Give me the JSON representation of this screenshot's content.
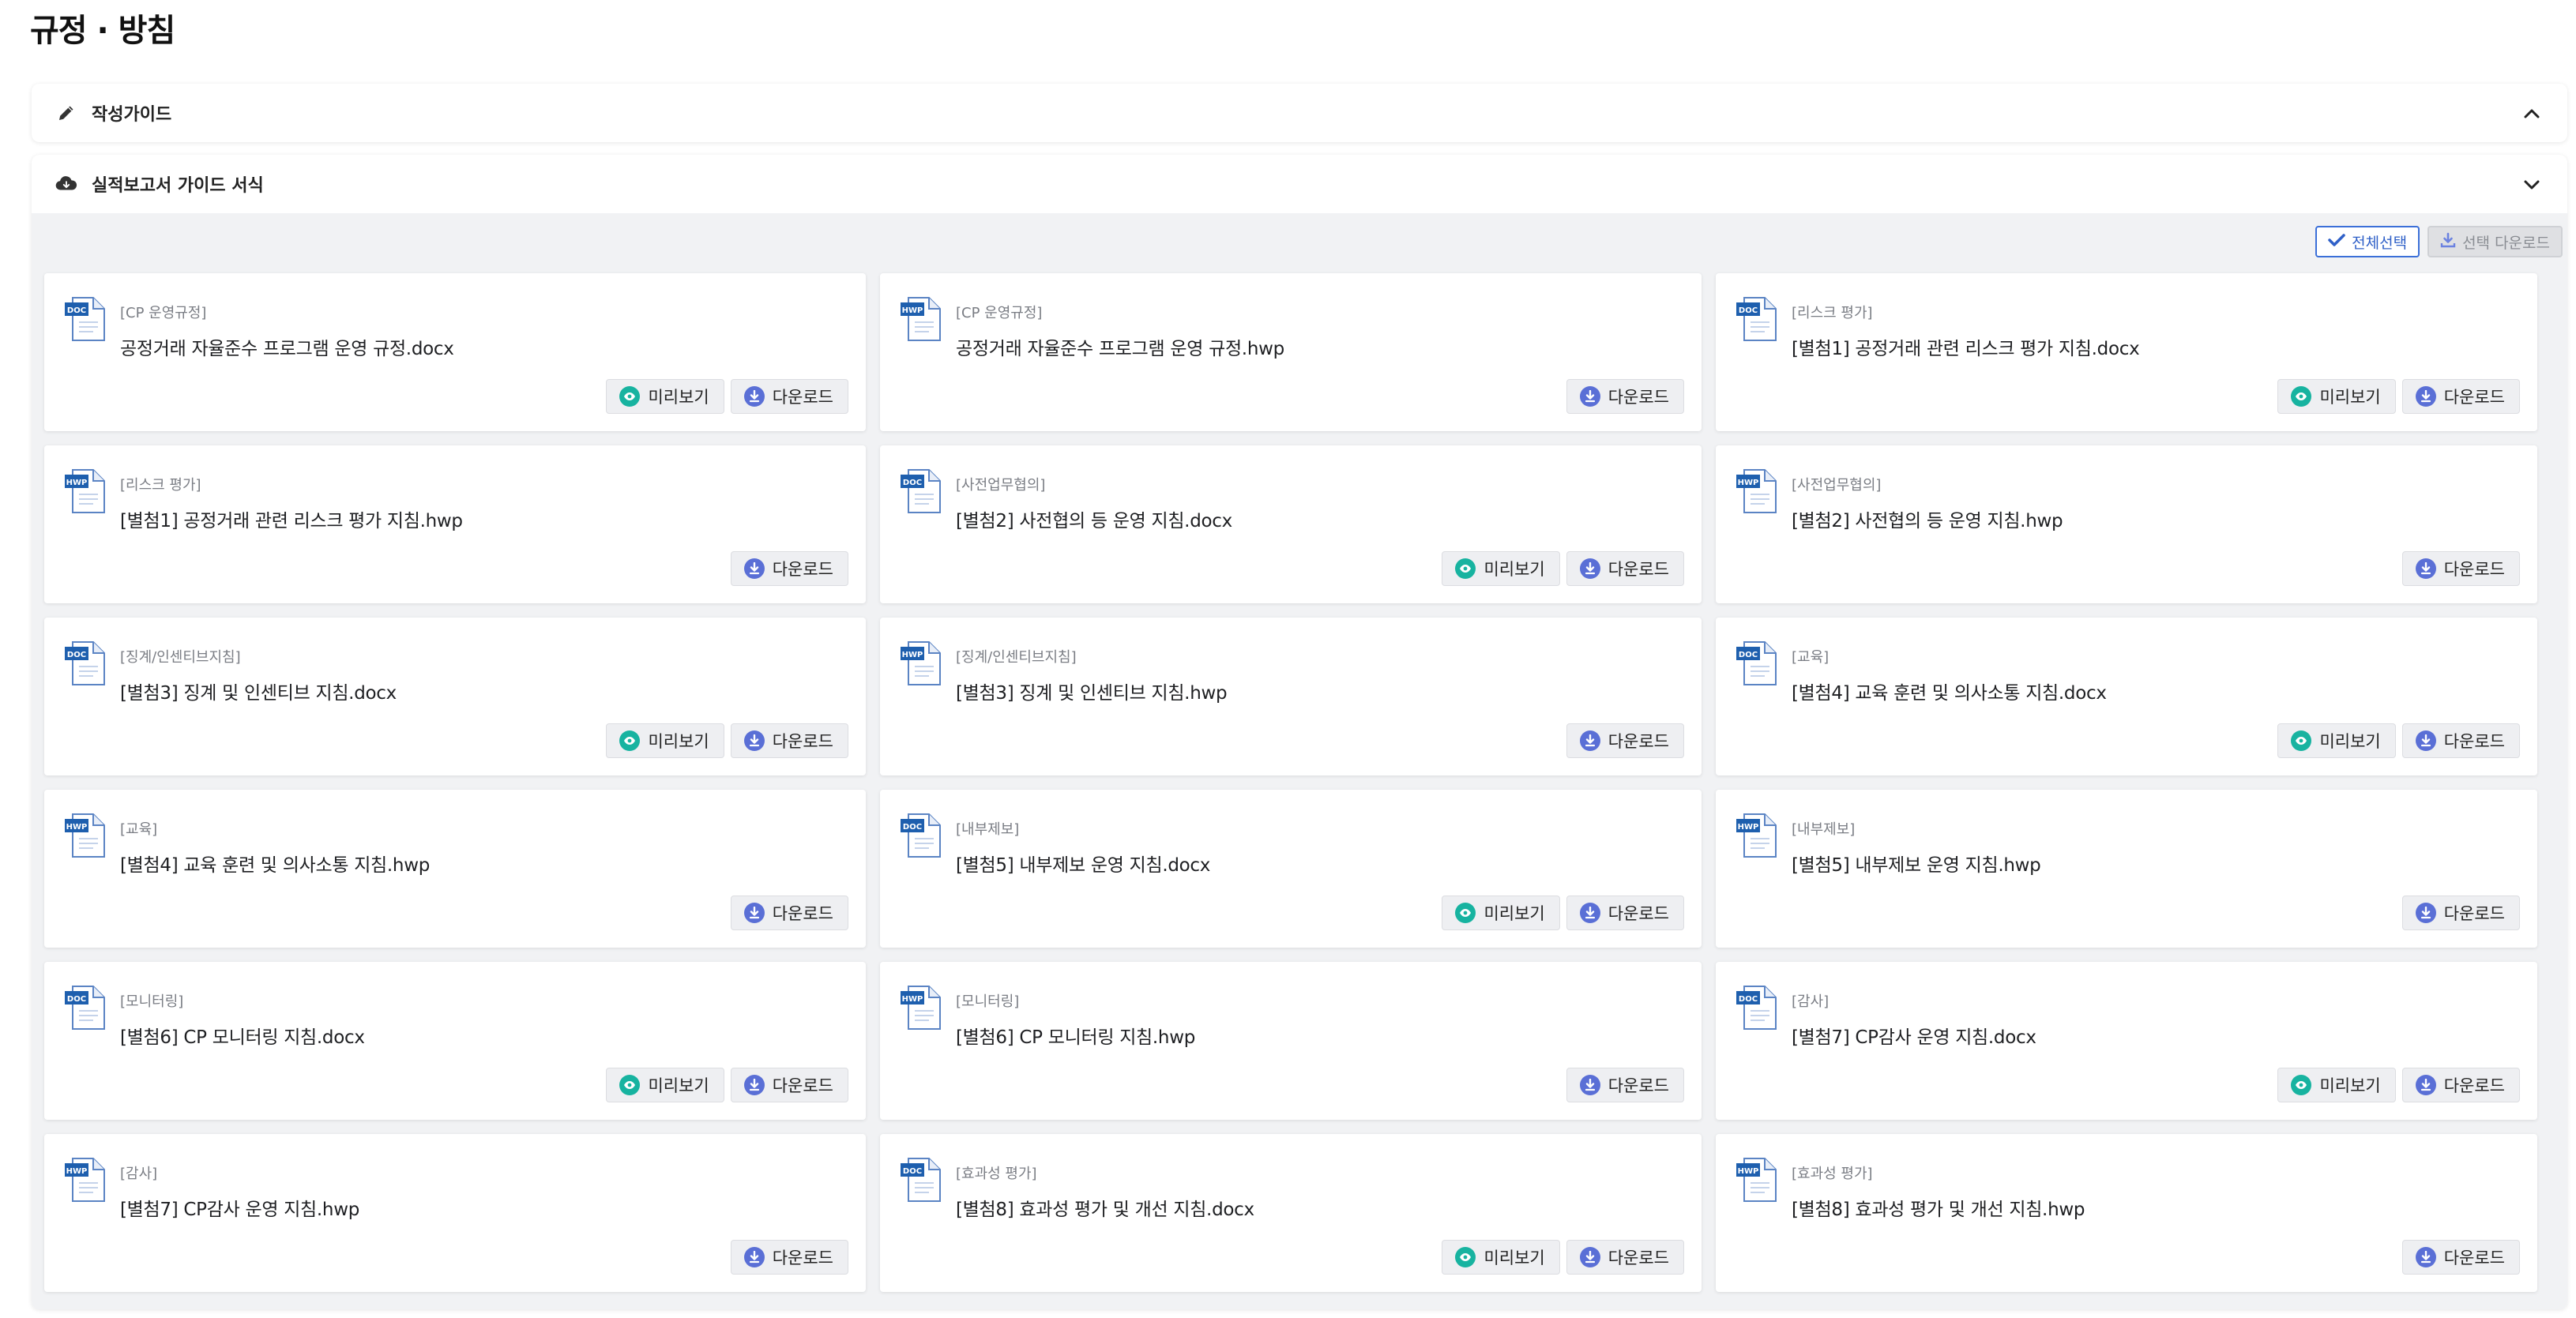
{
  "page": {
    "title": "규정 · 방침"
  },
  "accordion_guide": {
    "label": "작성가이드",
    "icon": "pencil-icon",
    "expanded_icon": "chevron-up-icon"
  },
  "accordion_report": {
    "label": "실적보고서 가이드 서식",
    "icon": "cloud-download-icon",
    "toggle_icon": "chevron-down-icon"
  },
  "toolbar": {
    "select_all_label": "전체선택",
    "download_selected_label": "선택 다운로드"
  },
  "buttons": {
    "preview_label": "미리보기",
    "download_label": "다운로드"
  },
  "colors": {
    "accent": "#3b6fd8",
    "preview_icon": "#17b3a0",
    "download_icon": "#5a6fd6",
    "doc_icon": "#1e5fae"
  },
  "files": [
    {
      "category": "[CP 운영규정]",
      "name": "공정거래 자율준수 프로그램 운영 규정.docx",
      "type": "DOC",
      "preview": true
    },
    {
      "category": "[CP 운영규정]",
      "name": "공정거래 자율준수 프로그램 운영 규정.hwp",
      "type": "HWP",
      "preview": false
    },
    {
      "category": "[리스크 평가]",
      "name": "[별첨1] 공정거래 관련 리스크 평가 지침.docx",
      "type": "DOC",
      "preview": true
    },
    {
      "category": "[리스크 평가]",
      "name": "[별첨1] 공정거래 관련 리스크 평가 지침.hwp",
      "type": "HWP",
      "preview": false
    },
    {
      "category": "[사전업무협의]",
      "name": "[별첨2] 사전협의 등 운영 지침.docx",
      "type": "DOC",
      "preview": true
    },
    {
      "category": "[사전업무협의]",
      "name": "[별첨2] 사전협의 등 운영 지침.hwp",
      "type": "HWP",
      "preview": false
    },
    {
      "category": "[징계/인센티브지침]",
      "name": "[별첨3] 징계 및 인센티브 지침.docx",
      "type": "DOC",
      "preview": true
    },
    {
      "category": "[징계/인센티브지침]",
      "name": "[별첨3] 징계 및 인센티브 지침.hwp",
      "type": "HWP",
      "preview": false
    },
    {
      "category": "[교육]",
      "name": "[별첨4] 교육 훈련 및 의사소통 지침.docx",
      "type": "DOC",
      "preview": true
    },
    {
      "category": "[교육]",
      "name": "[별첨4] 교육 훈련 및 의사소통 지침.hwp",
      "type": "HWP",
      "preview": false
    },
    {
      "category": "[내부제보]",
      "name": "[별첨5] 내부제보 운영 지침.docx",
      "type": "DOC",
      "preview": true
    },
    {
      "category": "[내부제보]",
      "name": "[별첨5] 내부제보 운영 지침.hwp",
      "type": "HWP",
      "preview": false
    },
    {
      "category": "[모니터링]",
      "name": "[별첨6] CP 모니터링 지침.docx",
      "type": "DOC",
      "preview": true
    },
    {
      "category": "[모니터링]",
      "name": "[별첨6] CP 모니터링 지침.hwp",
      "type": "HWP",
      "preview": false
    },
    {
      "category": "[감사]",
      "name": "[별첨7] CP감사 운영 지침.docx",
      "type": "DOC",
      "preview": true
    },
    {
      "category": "[감사]",
      "name": "[별첨7] CP감사 운영 지침.hwp",
      "type": "HWP",
      "preview": false
    },
    {
      "category": "[효과성 평가]",
      "name": "[별첨8] 효과성 평가 및 개선 지침.docx",
      "type": "DOC",
      "preview": true
    },
    {
      "category": "[효과성 평가]",
      "name": "[별첨8] 효과성 평가 및 개선 지침.hwp",
      "type": "HWP",
      "preview": false
    }
  ]
}
